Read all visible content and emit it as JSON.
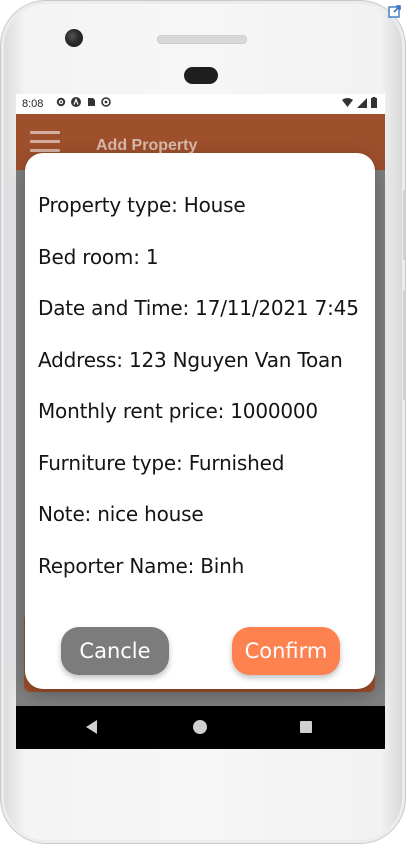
{
  "colors": {
    "accent": "#ff8350",
    "cancel": "#7c7c7c",
    "dialog_bg": "#ffffff",
    "scrim": "#7f7f7f"
  },
  "status_bar": {
    "time": "8:08",
    "icons": [
      "settings-icon",
      "a-icon",
      "sd-card-icon",
      "sync-icon"
    ],
    "right_icons": [
      "wifi-icon",
      "signal-icon",
      "battery-icon"
    ]
  },
  "app_bar": {
    "title": "Add Property",
    "menu_icon": "hamburger-icon"
  },
  "dialog": {
    "lines": [
      "Property type: House",
      "Bed room: 1",
      "Date and Time: 17/11/2021 7:45",
      "Address: 123 Nguyen Van Toan",
      "Monthly rent price: 1000000",
      "Furniture type: Furnished",
      "Note: nice house",
      "Reporter Name: Binh"
    ],
    "cancel_label": "Cancle",
    "confirm_label": "Confirm"
  },
  "nav_bar": {
    "icons": [
      "back-icon",
      "home-icon",
      "recents-icon"
    ]
  }
}
